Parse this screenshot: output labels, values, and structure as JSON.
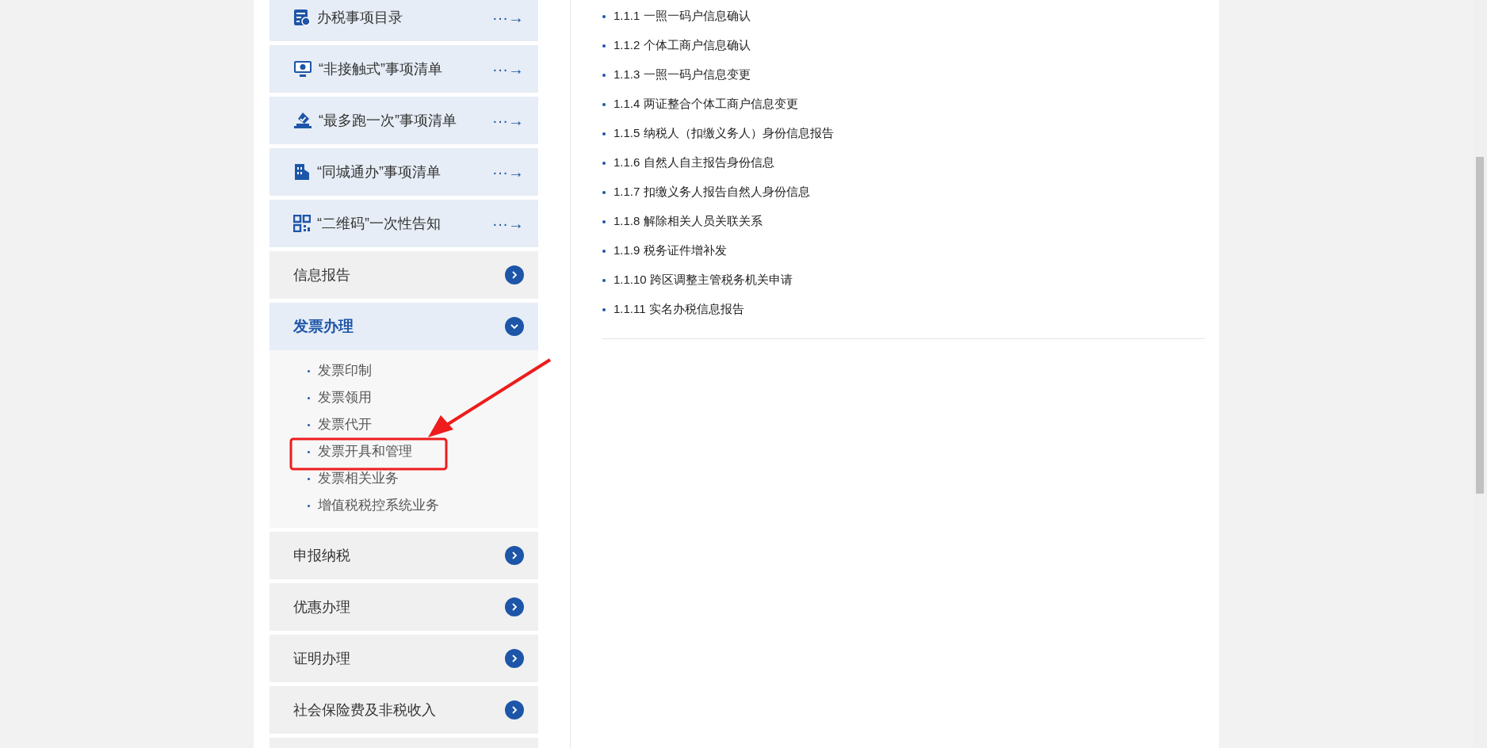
{
  "sidebar": {
    "items": [
      {
        "kind": "link",
        "label": "办税事项目录",
        "arrow": "···→"
      },
      {
        "kind": "link",
        "label": "“非接触式”事项清单",
        "arrow": "···→"
      },
      {
        "kind": "link",
        "label": "“最多跑一次”事项清单",
        "arrow": "···→"
      },
      {
        "kind": "link",
        "label": "“同城通办”事项清单",
        "arrow": "···→"
      },
      {
        "kind": "link",
        "label": "“二维码”一次性告知",
        "arrow": "···→"
      },
      {
        "kind": "category",
        "label": "信息报告",
        "expanded": false
      },
      {
        "kind": "category",
        "label": "发票办理",
        "expanded": true,
        "children": [
          {
            "label": "发票印制"
          },
          {
            "label": "发票领用"
          },
          {
            "label": "发票代开"
          },
          {
            "label": "发票开具和管理"
          },
          {
            "label": "发票相关业务"
          },
          {
            "label": "增值税税控系统业务"
          }
        ]
      },
      {
        "kind": "category",
        "label": "申报纳税",
        "expanded": false
      },
      {
        "kind": "category",
        "label": "优惠办理",
        "expanded": false
      },
      {
        "kind": "category",
        "label": "证明办理",
        "expanded": false
      },
      {
        "kind": "category",
        "label": "社会保险费及非税收入",
        "expanded": false
      }
    ]
  },
  "content": {
    "items": [
      "1.1.1 一照一码户信息确认",
      "1.1.2 个体工商户信息确认",
      "1.1.3 一照一码户信息变更",
      "1.1.4 两证整合个体工商户信息变更",
      "1.1.5 纳税人（扣缴义务人）身份信息报告",
      "1.1.6 自然人自主报告身份信息",
      "1.1.7 扣缴义务人报告自然人身份信息",
      "1.1.8 解除相关人员关联关系",
      "1.1.9 税务证件增补发",
      "1.1.10 跨区调整主管税务机关申请",
      "1.1.11 实名办税信息报告"
    ]
  }
}
